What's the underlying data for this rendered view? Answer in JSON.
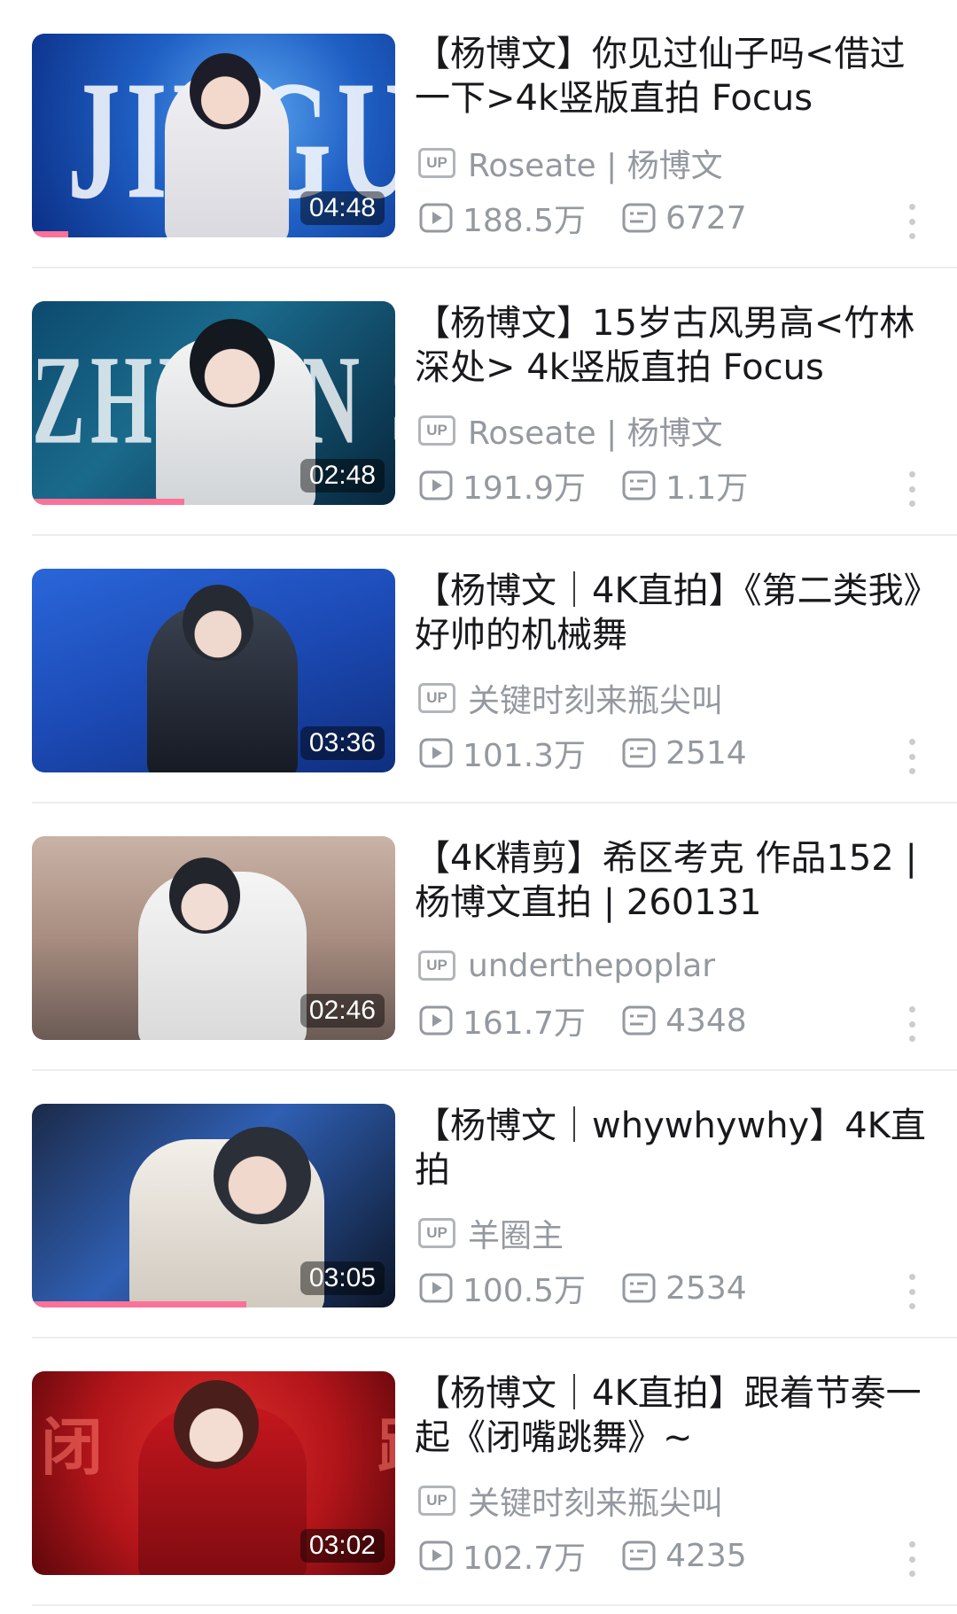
{
  "videos": [
    {
      "title": "【杨博文】你见过仙子吗<借过一下>4k竖版直拍 Focus",
      "uploader": "Roseate | 杨博文",
      "views": "188.5万",
      "danmaku": "6727",
      "duration": "04:48",
      "watched_fraction": 0.1,
      "thumb_text": "JIEGUOYIXIA",
      "up_badge": "UP"
    },
    {
      "title": "【杨博文】15岁古风男高<竹林深处> 4k竖版直拍 Focus",
      "uploader": "Roseate | 杨博文",
      "views": "191.9万",
      "danmaku": "1.1万",
      "duration": "02:48",
      "watched_fraction": 0.42,
      "thumb_text": "ZHUJIN SHENCHU",
      "up_badge": "UP"
    },
    {
      "title": "【杨博文｜4K直拍】《第二类我》好帅的机械舞",
      "uploader": "关键时刻来瓶尖叫",
      "views": "101.3万",
      "danmaku": "2514",
      "duration": "03:36",
      "watched_fraction": 0,
      "thumb_text": "",
      "up_badge": "UP"
    },
    {
      "title": "【4K精剪】希区考克 作品152 | 杨博文直拍 | 260131",
      "uploader": "underthepoplar",
      "views": "161.7万",
      "danmaku": "4348",
      "duration": "02:46",
      "watched_fraction": 0,
      "thumb_text": "",
      "up_badge": "UP"
    },
    {
      "title": "【杨博文｜whywhywhy】4K直拍",
      "uploader": "羊圈主",
      "views": "100.5万",
      "danmaku": "2534",
      "duration": "03:05",
      "watched_fraction": 0.59,
      "thumb_text": "",
      "up_badge": "UP"
    },
    {
      "title": "【杨博文｜4K直拍】跟着节奏一起《闭嘴跳舞》~",
      "uploader": "关键时刻来瓶尖叫",
      "views": "102.7万",
      "danmaku": "4235",
      "duration": "03:02",
      "watched_fraction": 0,
      "thumb_text": "闭嘴跳舞",
      "up_badge": "UP"
    }
  ],
  "colors": {
    "progress": "#fb7299",
    "meta_text": "#9499a0",
    "title_text": "#18191c"
  },
  "icons": [
    "play-count-icon",
    "danmaku-icon",
    "more-vertical-icon",
    "up-badge-icon"
  ]
}
